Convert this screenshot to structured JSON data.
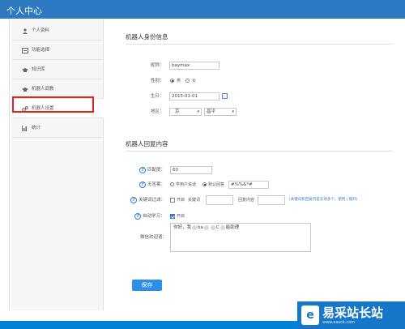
{
  "header": {
    "title": "个人中心"
  },
  "sidebar": {
    "items": [
      {
        "label": "个人资料",
        "icon": "user-icon"
      },
      {
        "label": "功能选择",
        "icon": "function-icon"
      },
      {
        "label": "知识库",
        "icon": "graduation-cap-icon"
      },
      {
        "label": "机器人调教",
        "icon": "graduation-cap-icon"
      },
      {
        "label": "机器人设置",
        "icon": "gears-icon",
        "active": true
      },
      {
        "label": "统计",
        "icon": "bar-chart-icon"
      }
    ]
  },
  "identity": {
    "title": "机器人身份信息",
    "nickname": {
      "label": "昵称：",
      "value": "baymax"
    },
    "gender": {
      "label": "性别：",
      "options": [
        "男",
        "女"
      ],
      "selected": "男"
    },
    "birthday": {
      "label": "生日：",
      "value": "2015-01-01"
    },
    "region": {
      "label": "地区：",
      "province": "京",
      "city": "昌平"
    }
  },
  "reply": {
    "title": "机器人回复内容",
    "match": {
      "label": "匹配度：",
      "value": "60"
    },
    "no_answer": {
      "label": "无答案：",
      "options": [
        "学用户说话",
        "默认回答"
      ],
      "selected": "默认回答",
      "value": "#%%&*#"
    },
    "keyword_filter": {
      "label": "关键词过滤：",
      "enable_label": "开启",
      "keyword_label": "关键词",
      "reply_label": "回复内容",
      "link_text": "(关键词和回复内容支持多个，使用 | 隔开)"
    },
    "auto_learn": {
      "label": "自动学习：",
      "enable_label": "开启",
      "checked": true
    },
    "welcome": {
      "label": "微信欢迎语：",
      "text_start": "你好，我",
      "text_mid": "ba",
      "text_mid2": "C",
      "text_end": "能助理"
    }
  },
  "actions": {
    "save_label": "保存"
  },
  "watermark": {
    "text": "易采站长站",
    "url": "www.easck.com"
  }
}
